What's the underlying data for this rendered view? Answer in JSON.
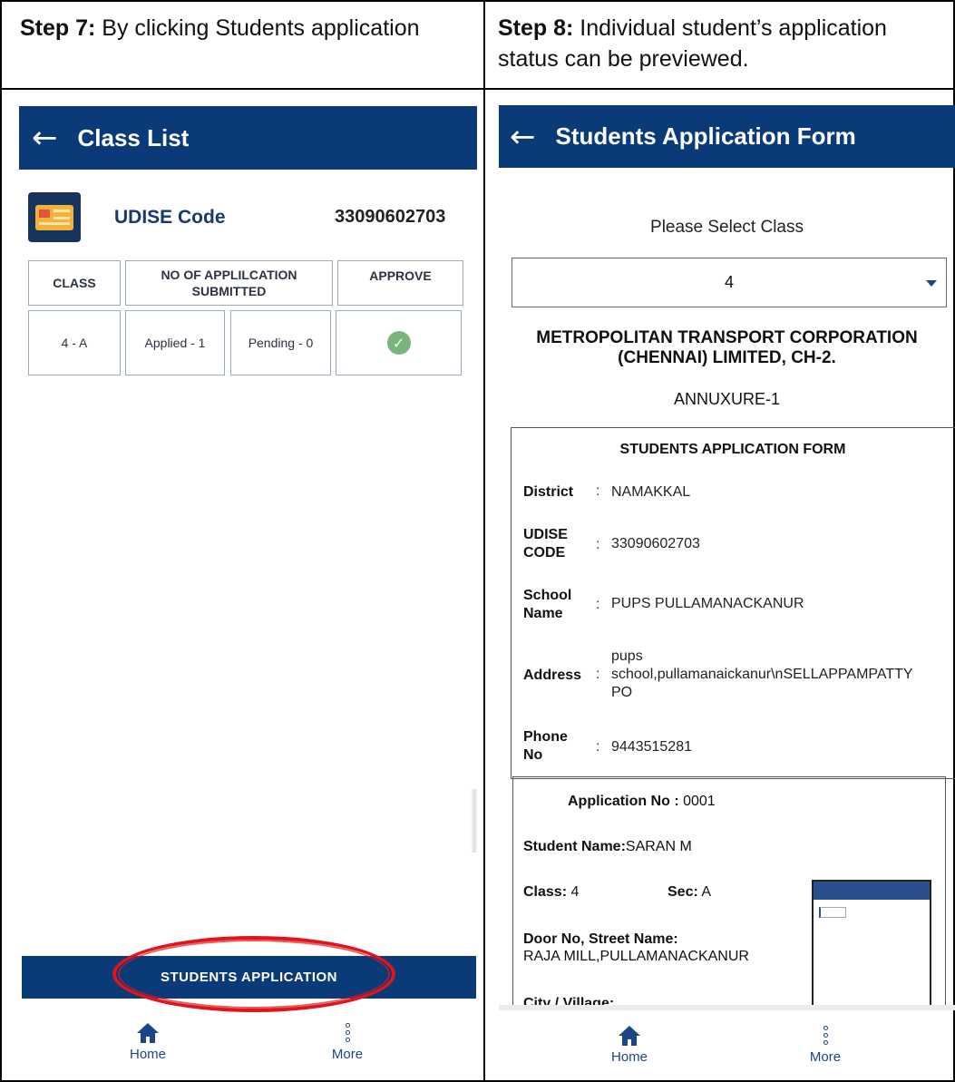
{
  "captions": {
    "left_step": "Step 7:",
    "left_text": " By clicking Students application",
    "right_step": "Step 8:",
    "right_text": " Individual student’s application status can be previewed."
  },
  "left_screen": {
    "appbar": {
      "back_icon": "←",
      "title": "Class List"
    },
    "udise": {
      "icon": "id-card-icon",
      "label": "UDISE Code",
      "value": "33090602703"
    },
    "table": {
      "headers": [
        "CLASS",
        "NO OF APPLILCATION SUBMITTED",
        "APPROVE"
      ],
      "row": {
        "class": "4 - A",
        "applied": "Applied - 1",
        "pending": "Pending - 0",
        "approve_icon": "✓"
      }
    },
    "students_button": "STUDENTS APPLICATION",
    "highlight_color": "#e0141b",
    "nav": {
      "home": "Home",
      "more": "More"
    }
  },
  "right_screen": {
    "appbar": {
      "back_icon": "←",
      "title": "Students Application Form"
    },
    "select": {
      "label": "Please Select Class",
      "value": "4"
    },
    "org_line1": "METROPOLITAN TRANSPORT CORPORATION",
    "org_line2": "(CHENNAI) LIMITED, CH-2.",
    "annexure": "ANNUXURE-1",
    "form": {
      "title": "STUDENTS APPLICATION FORM",
      "district_label": "District",
      "district_value": "NAMAKKAL",
      "udise_label_1": "UDISE",
      "udise_label_2": "CODE",
      "udise_value": "33090602703",
      "school_label_1": "School",
      "school_label_2": "Name",
      "school_value": "PUPS PULLAMANACKANUR",
      "address_label": "Address",
      "address_line1": "pups",
      "address_line2": "school,pullamanaickanur\\nSELLAPPAMPATTY",
      "address_line3": "PO",
      "phone_label_1": "Phone",
      "phone_label_2": "No",
      "phone_value": "9443515281",
      "colon": ":"
    },
    "application": {
      "no_label": "Application No :",
      "no_value": "0001",
      "student_label": "Student Name:",
      "student_value": "SARAN M",
      "class_label": "Class:",
      "class_value": "4",
      "sec_label": "Sec:",
      "sec_value": "A",
      "door_label": "Door No, Street Name:",
      "door_value": "RAJA MILL,PULLAMANACKANUR",
      "city_label": "City / Village:"
    },
    "nav": {
      "home": "Home",
      "more": "More"
    }
  },
  "colors": {
    "appbar": "#0b3a78",
    "nav_text": "#1c4586",
    "approve": "#79b57a"
  }
}
